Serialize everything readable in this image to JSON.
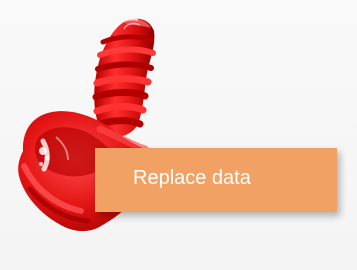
{
  "viewer": {
    "model_icon": "red-3d-screw-model",
    "model_color": "#e81818",
    "background_color": "#f7f7f7"
  },
  "context_menu": {
    "items": [
      {
        "label": "Replace data",
        "background_color": "#f2a164",
        "text_color": "#ffffff"
      }
    ]
  }
}
